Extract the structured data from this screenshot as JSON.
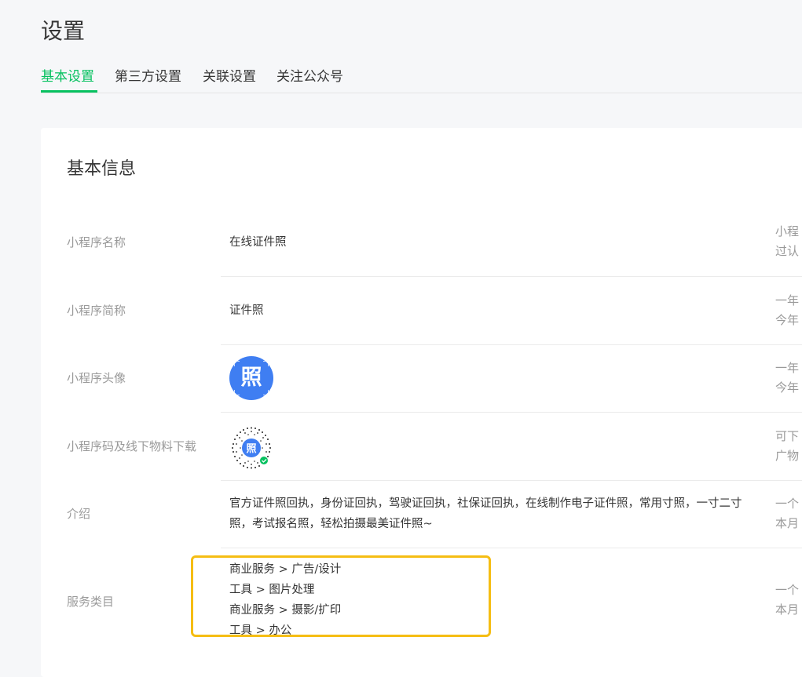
{
  "page": {
    "title": "设置"
  },
  "tabs": [
    {
      "label": "基本设置",
      "active": true
    },
    {
      "label": "第三方设置",
      "active": false
    },
    {
      "label": "关联设置",
      "active": false
    },
    {
      "label": "关注公众号",
      "active": false
    }
  ],
  "section": {
    "title": "基本信息"
  },
  "rows": {
    "name": {
      "label": "小程序名称",
      "value": "在线证件照",
      "hint_1": "小程",
      "hint_2": "过认"
    },
    "short_name": {
      "label": "小程序简称",
      "value": "证件照",
      "hint_1": "一年",
      "hint_2": "今年"
    },
    "avatar": {
      "label": "小程序头像",
      "glyph": "照",
      "icon": "avatar-photo-icon",
      "hint_1": "一年",
      "hint_2": "今年"
    },
    "qrcode": {
      "label": "小程序码及线下物料下载",
      "glyph": "照",
      "icon": "mini-program-code-icon",
      "hint_1": "可下",
      "hint_2": "广物"
    },
    "intro": {
      "label": "介绍",
      "value": "官方证件照回执，身份证回执，驾驶证回执，社保证回执，在线制作电子证件照，常用寸照，一寸二寸照，考试报名照，轻松拍摄最美证件照~",
      "hint_1": "一个",
      "hint_2": "本月"
    },
    "category": {
      "label": "服务类目",
      "items": [
        "商业服务 > 广告/设计",
        "工具 > 图片处理",
        "商业服务 > 摄影/扩印",
        "工具 > 办公"
      ],
      "hint_1": "一个",
      "hint_2": "本月"
    }
  },
  "colors": {
    "accent": "#07c160",
    "avatar_bg": "#3f7ef2",
    "highlight": "#f5bd13"
  }
}
